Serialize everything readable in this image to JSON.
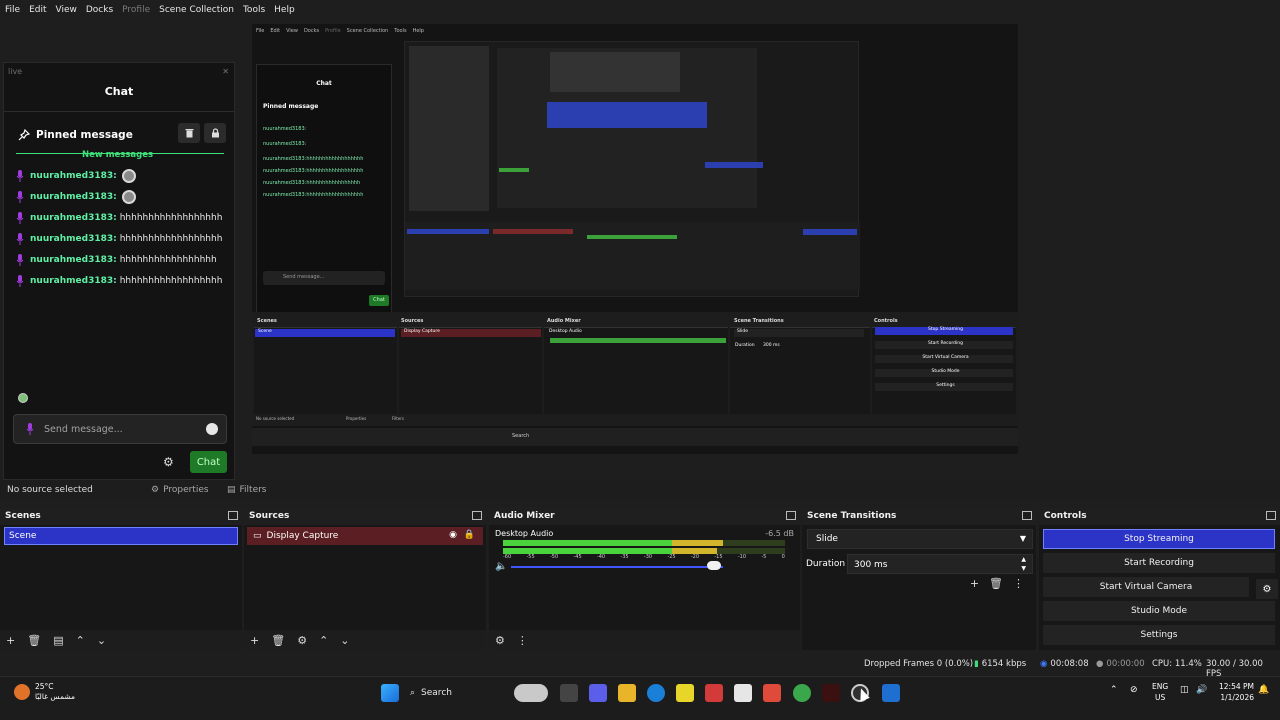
{
  "menu": [
    "File",
    "Edit",
    "View",
    "Docks",
    "Profile",
    "Scene Collection",
    "Tools",
    "Help"
  ],
  "chat_dock": {
    "dock_title": "live",
    "title": "Chat",
    "pinned_label": "Pinned message",
    "new_messages": "New messages",
    "messages": [
      {
        "user": "nuurahmed3183:",
        "text": ""
      },
      {
        "user": "nuurahmed3183:",
        "text": ""
      },
      {
        "user": "nuurahmed3183:",
        "text": "hhhhhhhhhhhhhhhhhh"
      },
      {
        "user": "nuurahmed3183:",
        "text": "hhhhhhhhhhhhhhhhhh"
      },
      {
        "user": "nuurahmed3183:",
        "text": "hhhhhhhhhhhhhhhhh"
      },
      {
        "user": "nuurahmed3183:",
        "text": "hhhhhhhhhhhhhhhhhh"
      }
    ],
    "send_placeholder": "Send message...",
    "chat_button": "Chat"
  },
  "preview": {
    "menu": [
      "File",
      "Edit",
      "View",
      "Docks",
      "Profile",
      "Scene Collection",
      "Tools",
      "Help"
    ],
    "chat_title": "Chat",
    "pinned": "Pinned message",
    "messages": [
      "nuurahmed3183:",
      "nuurahmed3183:",
      "nuurahmed3183:hhhhhhhhhhhhhhhhhh",
      "nuurahmed3183:hhhhhhhhhhhhhhhhhh",
      "nuurahmed3183:hhhhhhhhhhhhhhhhh",
      "nuurahmed3183:hhhhhhhhhhhhhhhhhh"
    ],
    "send": "Send message...",
    "chat_btn": "Chat",
    "no_source": "No source selected",
    "properties": "Properties",
    "filters": "Filters",
    "panels": [
      "Scenes",
      "Sources",
      "Audio Mixer",
      "Scene Transitions",
      "Controls"
    ],
    "scene": "Scene",
    "source": "Display Capture",
    "desktop_audio": "Desktop Audio",
    "transition": "Slide",
    "duration_label": "Duration",
    "duration": "300 ms",
    "controls": [
      "Stop Streaming",
      "Start Recording",
      "Start Virtual Camera",
      "Studio Mode",
      "Settings"
    ],
    "search": "Search"
  },
  "properties_bar": {
    "no_source": "No source selected",
    "properties": "Properties",
    "filters": "Filters"
  },
  "scenes": {
    "title": "Scenes",
    "items": [
      "Scene"
    ]
  },
  "sources": {
    "title": "Sources",
    "items": [
      "Display Capture"
    ]
  },
  "mixer": {
    "title": "Audio Mixer",
    "channel": "Desktop Audio",
    "db": "-6.5 dB",
    "ticks": [
      "-60",
      "-55",
      "-50",
      "-45",
      "-40",
      "-35",
      "-30",
      "-25",
      "-20",
      "-15",
      "-10",
      "-5",
      "0"
    ],
    "level": 0.78
  },
  "transitions": {
    "title": "Scene Transitions",
    "selected": "Slide",
    "duration_label": "Duration",
    "duration": "300 ms"
  },
  "controls": {
    "title": "Controls",
    "stop_streaming": "Stop Streaming",
    "start_recording": "Start Recording",
    "start_virtual_camera": "Start Virtual Camera",
    "studio_mode": "Studio Mode",
    "settings": "Settings"
  },
  "status": {
    "dropped": "Dropped Frames 0 (0.0%)",
    "bitrate": "6154 kbps",
    "stream_time": "00:08:08",
    "rec_time": "00:00:00",
    "cpu": "CPU: 11.4%",
    "fps": "30.00 / 30.00 FPS"
  },
  "taskbar": {
    "temp": "25°C",
    "weather": "مشمس غالبًا",
    "search": "Search",
    "lang1": "ENG",
    "lang2": "US",
    "time": "12:54 PM",
    "date": "1/1/2026"
  },
  "colors": {
    "accent": "#2b34c7",
    "green": "#3ee07a",
    "chat_btn": "#1f7a28",
    "source_bg": "#5b1e22"
  }
}
